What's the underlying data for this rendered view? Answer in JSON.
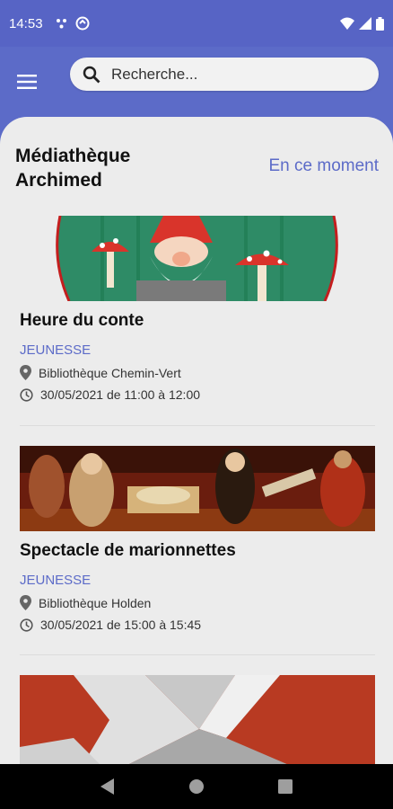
{
  "status_bar": {
    "time": "14:53"
  },
  "search": {
    "placeholder": "Recherche..."
  },
  "header": {
    "library_name": "Médiathèque Archimed",
    "now_link": "En ce moment"
  },
  "events": [
    {
      "title": "Heure du conte",
      "category": "JEUNESSE",
      "location": "Bibliothèque Chemin-Vert",
      "datetime": "30/05/2021 de 11:00 à 12:00"
    },
    {
      "title": "Spectacle de marionnettes",
      "category": "JEUNESSE",
      "location": "Bibliothèque Holden",
      "datetime": "30/05/2021 de 15:00 à 15:45"
    }
  ],
  "colors": {
    "primary": "#5c6bc8",
    "background": "#ececec"
  }
}
